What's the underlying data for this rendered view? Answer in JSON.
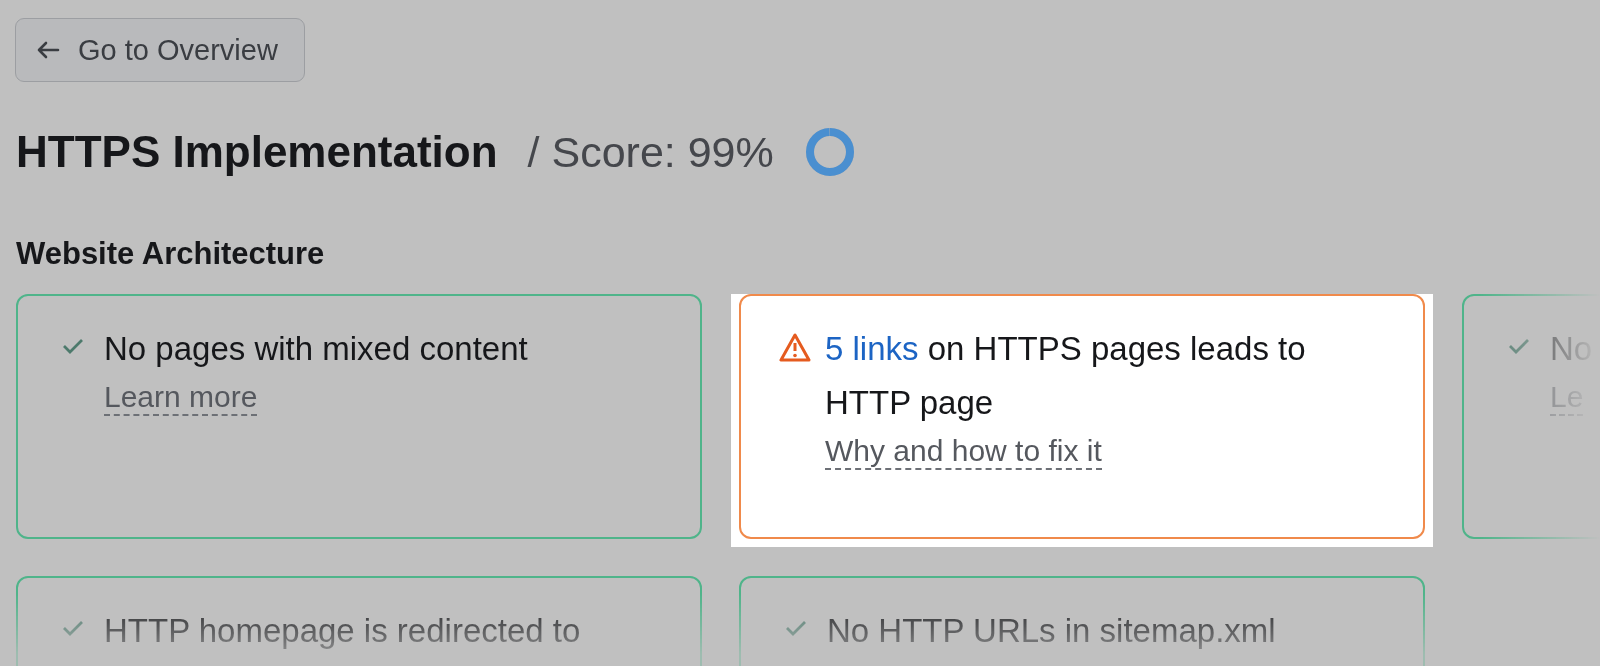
{
  "back_button": {
    "label": "Go to Overview"
  },
  "heading": {
    "title": "HTTPS Implementation",
    "score": "/ Score: 99%",
    "level": 0.99
  },
  "section": {
    "title": "Website Architecture"
  },
  "cards": [
    {
      "kind": "ok",
      "title": "No pages with mixed content",
      "link": "Learn more",
      "highlighted": false
    },
    {
      "kind": "warning",
      "count_link": "5 links",
      "title": " on HTTPS pages leads to HTTP page",
      "link": "Why and how to fix it",
      "highlighted": true
    },
    {
      "kind": "ok",
      "title": "No",
      "link": "Le",
      "highlighted": false
    },
    {
      "kind": "ok",
      "title": "HTTP homepage is redirected to",
      "highlighted": false
    },
    {
      "kind": "ok",
      "title": "No HTTP URLs in sitemap.xml",
      "highlighted": false
    }
  ]
}
